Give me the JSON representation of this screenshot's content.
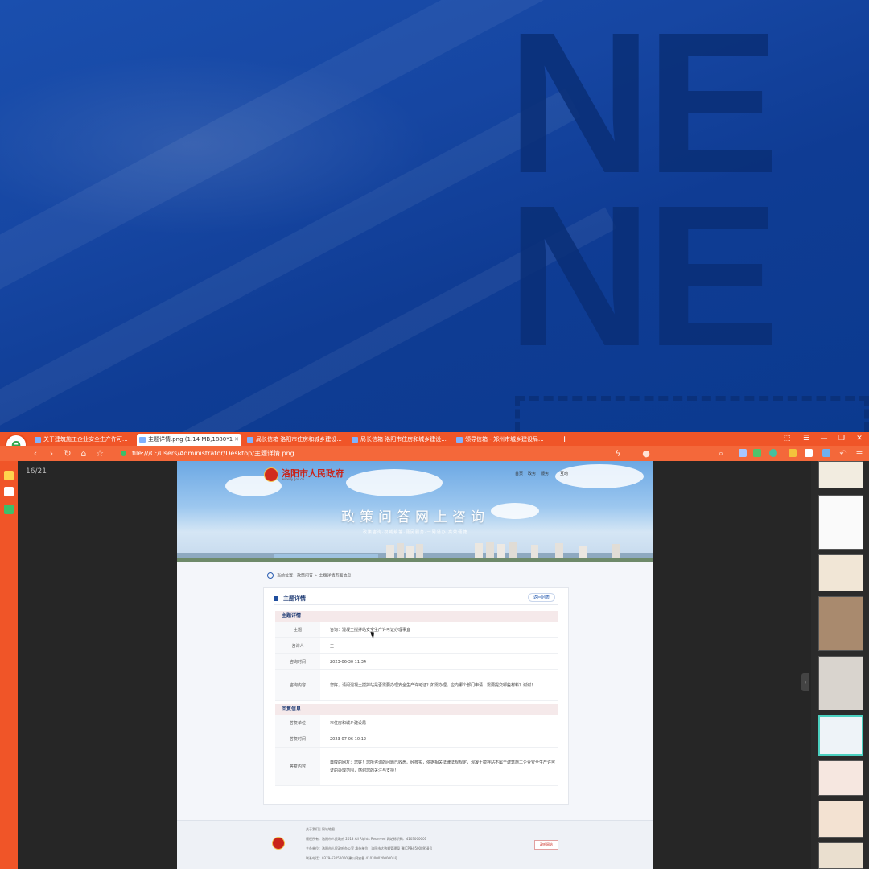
{
  "browser": {
    "tabs": [
      {
        "label": "关于建筑施工企业安全生产许可..."
      },
      {
        "label": "主题详情.png (1.14 MB,1880*1"
      },
      {
        "label": "局长信箱 洛阳市住房和城乡建设..."
      },
      {
        "label": "局长信箱 洛阳市住房和城乡建设..."
      },
      {
        "label": "领导信箱 - 郑州市城乡建设局..."
      }
    ],
    "new_tab": "+",
    "address": "file:///C:/Users/Administrator/Desktop/主题详情.png",
    "image_counter": "16/21",
    "theme_color": "#f05528"
  },
  "page": {
    "site_name": "洛阳市人民政府",
    "site_sub": "www.ly.gov.cn",
    "nav": [
      "首页",
      "政务",
      "服务",
      "互动"
    ],
    "banner_title": "政策问答网上咨询",
    "banner_sub": "政策咨询·权威解答·便民服务·一网通办·高效便捷",
    "breadcrumb": "当前位置：政策问答 > 主题详情页面信息",
    "card_title": "主题详情",
    "back_label": "返回列表",
    "section1": "主题详情",
    "section2": "回复信息",
    "rows1": [
      {
        "label": "主题",
        "value": "咨询：混凝土搅拌站安全生产许可证办理事宜"
      },
      {
        "label": "咨询人",
        "value": "王"
      },
      {
        "label": "咨询时间",
        "value": "2023-06-30 11:34"
      },
      {
        "label": "咨询内容",
        "value": "您好，请问混凝土搅拌站是否需要办理安全生产许可证？如需办理，应向哪个部门申请、需要提交哪些材料？谢谢！"
      }
    ],
    "rows2": [
      {
        "label": "答复单位",
        "value": "市住房和城乡建设局"
      },
      {
        "label": "答复时间",
        "value": "2023-07-06 10:12"
      },
      {
        "label": "答复内容",
        "value": "尊敬的网友：您好！您所咨询的问题已收悉。经核实，依据相关法律法规规定，混凝土搅拌站不属于建筑施工企业安全生产许可证的办理范围，感谢您的关注与支持！"
      }
    ],
    "footer": [
      "关于我们 | 网站地图",
      "版权所有：洛阳市人民政府 2013 All Rights Reserved 网站标识码：4103000001",
      "主办单位：洛阳市人民政府办公室 承办单位：洛阳市大数据管理局 豫ICP备05008958号",
      "联系电话：0379-63250000 豫公网安备 41030002000001号"
    ],
    "footer_badge": "政府网站"
  }
}
